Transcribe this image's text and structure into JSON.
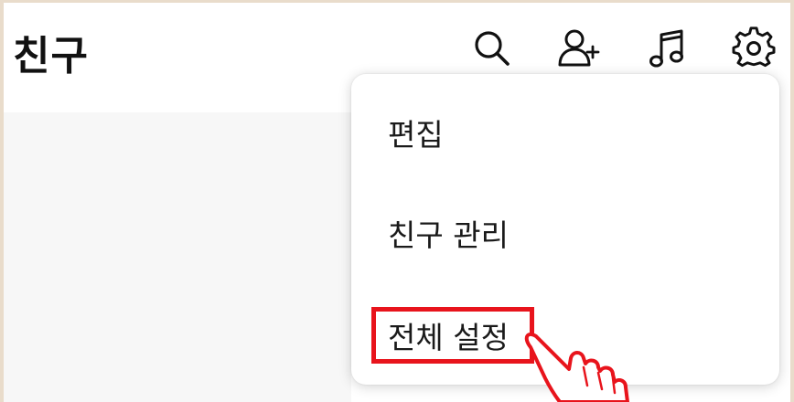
{
  "header": {
    "title": "친구"
  },
  "toolbar": {
    "icons": [
      "search-icon",
      "add-friend-icon",
      "music-icon",
      "settings-icon"
    ]
  },
  "menu": {
    "items": [
      {
        "label": "편집"
      },
      {
        "label": "친구 관리"
      },
      {
        "label": "전체 설정"
      }
    ],
    "highlighted_item": "전체 설정"
  },
  "colors": {
    "highlight": "#e8141c",
    "background": "#e9dccb"
  }
}
